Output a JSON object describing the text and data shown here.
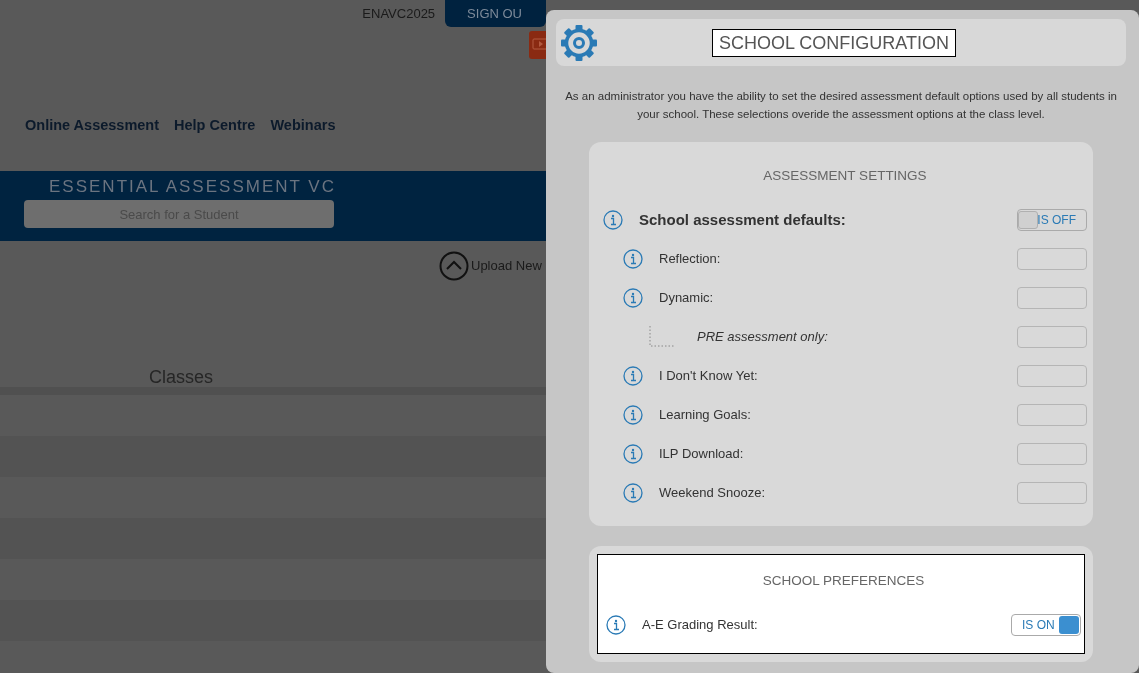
{
  "top_bar": {
    "account": "ENAVC2025",
    "sign_out": "SIGN OU"
  },
  "nav": [
    "Online Assessment",
    "Help Centre",
    "Webinars"
  ],
  "banner": {
    "title": "ESSENTIAL ASSESSMENT VC",
    "search": {
      "placeholder": "Search for a Student"
    }
  },
  "upload": {
    "label": "Upload New"
  },
  "classes": {
    "title": "Classes"
  },
  "dialog": {
    "title": "SCHOOL CONFIGURATION",
    "intro": "As an administrator you have the ability to set the desired assessment default options used by all students in your school. These selections overide the assessment options at the class level.",
    "sections": [
      {
        "title": "ASSESSMENT SETTINGS",
        "focused": false,
        "items": [
          {
            "label": "School assessment defaults:",
            "toggle_text": "IS OFF",
            "on": false,
            "disabled": false,
            "children": [
              {
                "label": "Reflection:",
                "disabled": true
              },
              {
                "label": "Dynamic:",
                "disabled": true,
                "children": [
                  {
                    "label": "PRE assessment only:",
                    "disabled": true
                  }
                ]
              },
              {
                "label": "I Don't Know Yet:",
                "disabled": true
              },
              {
                "label": "Learning Goals:",
                "disabled": true
              },
              {
                "label": "ILP Download:",
                "disabled": true
              },
              {
                "label": "Weekend Snooze:",
                "disabled": true
              }
            ]
          }
        ]
      },
      {
        "title": "SCHOOL PREFERENCES",
        "focused": true,
        "items": [
          {
            "label": "A-E Grading Result:",
            "toggle_text": "IS ON",
            "on": true,
            "disabled": false
          }
        ]
      }
    ]
  }
}
